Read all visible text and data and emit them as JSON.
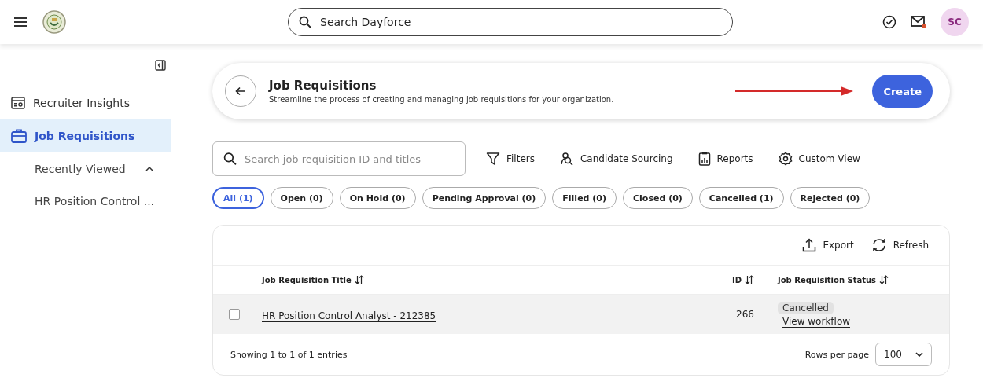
{
  "header": {
    "search": {
      "placeholder": "Search Dayforce"
    },
    "notification": true,
    "avatar": "SC"
  },
  "sidebar": {
    "items": [
      {
        "label": "Recruiter Insights",
        "kind": "insights",
        "selected": false
      },
      {
        "label": "Job Requisitions",
        "kind": "briefcase",
        "selected": true
      }
    ],
    "recent": {
      "label": "Recently Viewed",
      "expanded": true,
      "children": [
        {
          "label": "HR Position Control ..."
        }
      ]
    }
  },
  "page_header": {
    "title": "Job Requisitions",
    "subtitle": "Streamline the process of creating and managing job requisitions for your organization.",
    "button": "Create"
  },
  "toolbar": {
    "search": {
      "placeholder": "Search job requisition ID and titles"
    },
    "actions": [
      {
        "label": "Filters",
        "kind": "filter"
      },
      {
        "label": "Candidate Sourcing",
        "kind": "sourcing"
      },
      {
        "label": "Reports",
        "kind": "reports"
      },
      {
        "label": "Custom View",
        "kind": "settings"
      }
    ]
  },
  "chips": [
    {
      "label": "All (1)",
      "selected": true
    },
    {
      "label": "Open (0)",
      "selected": false
    },
    {
      "label": "On Hold (0)",
      "selected": false
    },
    {
      "label": "Pending Approval (0)",
      "selected": false
    },
    {
      "label": "Filled (0)",
      "selected": false
    },
    {
      "label": "Closed (0)",
      "selected": false
    },
    {
      "label": "Cancelled (1)",
      "selected": false
    },
    {
      "label": "Rejected (0)",
      "selected": false
    }
  ],
  "table": {
    "actions": [
      {
        "label": "Export",
        "kind": "export"
      },
      {
        "label": "Refresh",
        "kind": "refresh"
      }
    ],
    "columns": [
      "Job Requisition Title",
      "ID",
      "Job Requisition Status"
    ],
    "rows": [
      {
        "checked": false,
        "title": "HR Position Control Analyst - 212385",
        "id": "266",
        "status": "Cancelled",
        "link": "View workflow"
      }
    ],
    "footer": "Showing 1 to 1 of 1 entries",
    "rows_per_page": {
      "label": "Rows per page",
      "value": "100"
    }
  }
}
